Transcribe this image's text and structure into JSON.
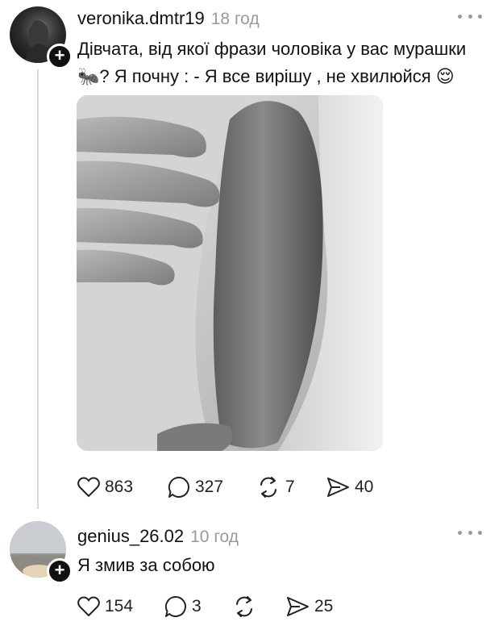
{
  "posts": [
    {
      "username": "veronika.dmtr19",
      "time": "18 год",
      "text_line1": "Дівчата, від якої фрази чоловіка у вас мурашки",
      "text_line2": "🐜? Я почну : - Я все вирішу , не хвилюйся 😌",
      "has_image": true,
      "image_icon": "black-and-white-photo-hand-on-arm",
      "likes": "863",
      "replies": "327",
      "reposts": "7",
      "shares": "40"
    },
    {
      "username": "genius_26.02",
      "time": "10 год",
      "text_line1": "Я змив за собою",
      "likes": "154",
      "replies": "3",
      "reposts": "",
      "shares": "25"
    }
  ],
  "follow_badge_symbol": "+",
  "colors": {
    "text": "#111111",
    "muted": "#9a9a9a",
    "thread_line": "#d9d9d9",
    "background": "#ffffff"
  }
}
